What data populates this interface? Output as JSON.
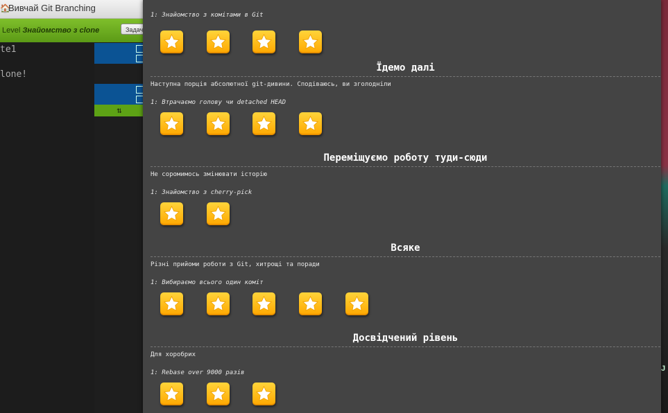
{
  "app": {
    "title": "Вивчай Git Branching",
    "home_glyph": "🏠",
    "level_prefix": "Level",
    "level_name": "Знайомство з clone",
    "header_button": "Задачі"
  },
  "code_lines": [
    "te1",
    "lone!"
  ],
  "sync_glyph": "⇅",
  "top_level_partial": {
    "level": "1: Знайомство з комітами в Git"
  },
  "sections": [
    {
      "title": "Їдемо далі",
      "description": "Наступна порція абсолютної git-дивини. Сподіваюсь, ви зголодніли",
      "level": "1: Втрачаємо голову чи detached HEAD"
    },
    {
      "title": "Переміщуємо роботу туди-сюди",
      "description": "Не соромимось змінювати історію",
      "level": "1: Знайомство з cherry-pick"
    },
    {
      "title": "Всяке",
      "description": "Різні прийоми роботи з Git, хитрощі та поради",
      "level": "1: Вибираємо всього один коміт"
    },
    {
      "title": "Досвідчений рівень",
      "description": "Для хоробрих",
      "level": "1: Rebase over 9000 разів"
    }
  ],
  "star_counts": [
    4,
    4,
    2,
    5,
    3
  ],
  "right_edge_text": "J",
  "colors": {
    "dialog_bg": "#444444",
    "star_gold": "#ffc21a",
    "level_bar_green": "#6aab1f"
  }
}
